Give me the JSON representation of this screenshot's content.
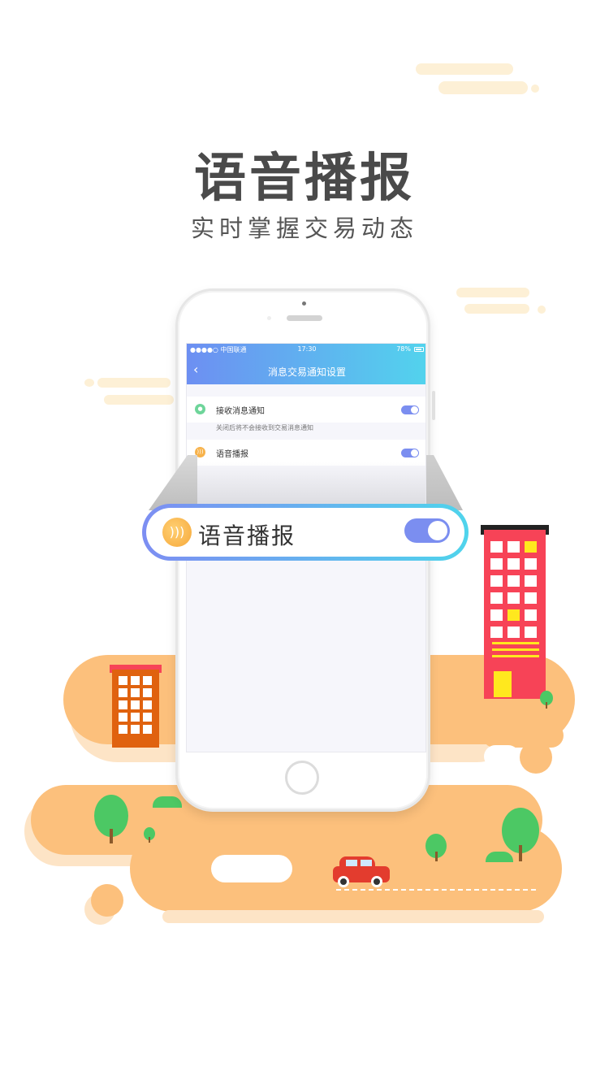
{
  "hero": {
    "title": "语音播报",
    "subtitle": "实时掌握交易动态"
  },
  "phone_screen": {
    "statusbar": {
      "carrier": "●●●●○ 中国联通",
      "time": "17:30",
      "battery": "78%"
    },
    "navbar": {
      "back_icon": "‹",
      "title": "消息交易通知设置"
    },
    "settings": [
      {
        "label": "接收消息通知",
        "icon": "chat-bubble-icon",
        "enabled": true,
        "hint": "关闭后将不会接收到交易消息通知"
      },
      {
        "label": "语音播报",
        "icon": "sound-wave-icon",
        "enabled": true
      }
    ]
  },
  "zoom_card": {
    "label": "语音播报",
    "icon": "sound-wave-icon",
    "enabled": true
  },
  "colors": {
    "gradient_start": "#6d8ff2",
    "gradient_end": "#52d3ed",
    "toggle_on": "#7b8ef0",
    "land": "#fcc07c",
    "building_red": "#f74357",
    "building_orange": "#e0620f",
    "tree_green": "#4cc864"
  }
}
